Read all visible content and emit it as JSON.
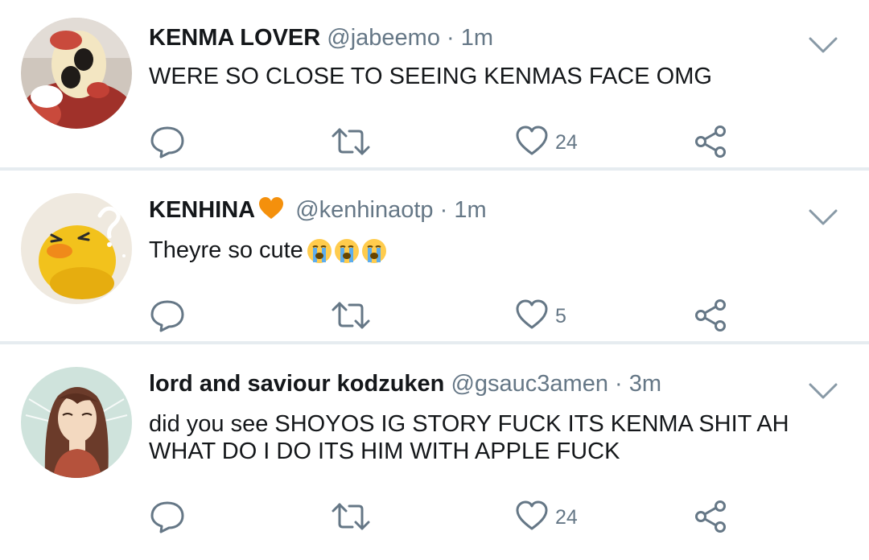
{
  "tweets": [
    {
      "display_name": "KENMA LOVER",
      "handle": "@jabeemo",
      "separator": "·",
      "time": "1m",
      "text": "WERE SO CLOSE TO SEEING KENMAS FACE OMG",
      "likes": "24"
    },
    {
      "display_name": "KENHINA",
      "handle": "@kenhinaotp",
      "separator": "·",
      "time": "1m",
      "text": "Theyre so cute",
      "likes": "5",
      "name_badge_icon": "orange-heart-icon",
      "emojis": [
        "loudly-crying-face-icon",
        "loudly-crying-face-icon",
        "loudly-crying-face-icon"
      ]
    },
    {
      "display_name": "lord and saviour kodzuken",
      "handle": "@gsauc3amen",
      "separator": "·",
      "time": "3m",
      "text": "did you see SHOYOS IG STORY FUCK ITS KENMA SHIT AH WHAT DO I DO ITS HIM WITH APPLE FUCK",
      "likes": "24"
    }
  ],
  "icons": {
    "reply": "reply-icon",
    "retweet": "retweet-icon",
    "like": "heart-icon",
    "share": "share-icon",
    "menu": "chevron-down-icon"
  },
  "colors": {
    "text": "#14171a",
    "secondary": "#657786",
    "divider": "#e6ecf0",
    "badge": "#f4900c"
  }
}
